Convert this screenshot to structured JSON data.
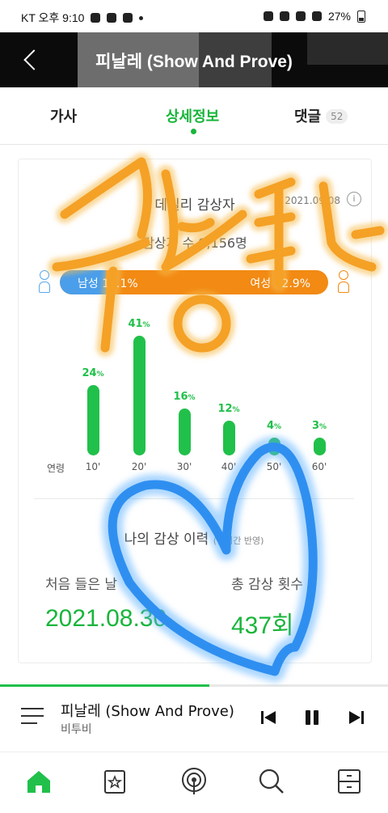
{
  "status_bar": {
    "left_text": "KT 오후 9:10",
    "battery": "27%"
  },
  "header": {
    "title": "피날레 (Show And Prove)"
  },
  "tabs": [
    {
      "label": "가사"
    },
    {
      "label": "상세정보"
    },
    {
      "label": "댓글",
      "badge": "52"
    }
  ],
  "daily": {
    "title": "데일리 감상자",
    "date": "2021.09.08",
    "listeners": "감상자 수 9,156명",
    "male_label": "남성 17.1%",
    "female_label": "여성 82.9%",
    "male_share": 17.1
  },
  "age_chart": {
    "axis_label": "연령",
    "groups": [
      {
        "label": "10'",
        "pct": 24
      },
      {
        "label": "20'",
        "pct": 41
      },
      {
        "label": "30'",
        "pct": 16
      },
      {
        "label": "40'",
        "pct": 12
      },
      {
        "label": "50'",
        "pct": 4
      },
      {
        "label": "60'",
        "pct": 3
      }
    ]
  },
  "history": {
    "title": "나의 감상 이력",
    "note": "(실시간 반영)",
    "first_label": "처음 들은 날",
    "first_value": "2021.08.30",
    "count_label": "총 감상 횟수",
    "count_value": "437회"
  },
  "player": {
    "song": "피날레 (Show And Prove)",
    "artist": "비투비",
    "progress": 0.54
  },
  "overlay_text": "국동탄",
  "colors": {
    "accent": "#19b53b",
    "male": "#4a9eea",
    "female": "#f28a13"
  }
}
